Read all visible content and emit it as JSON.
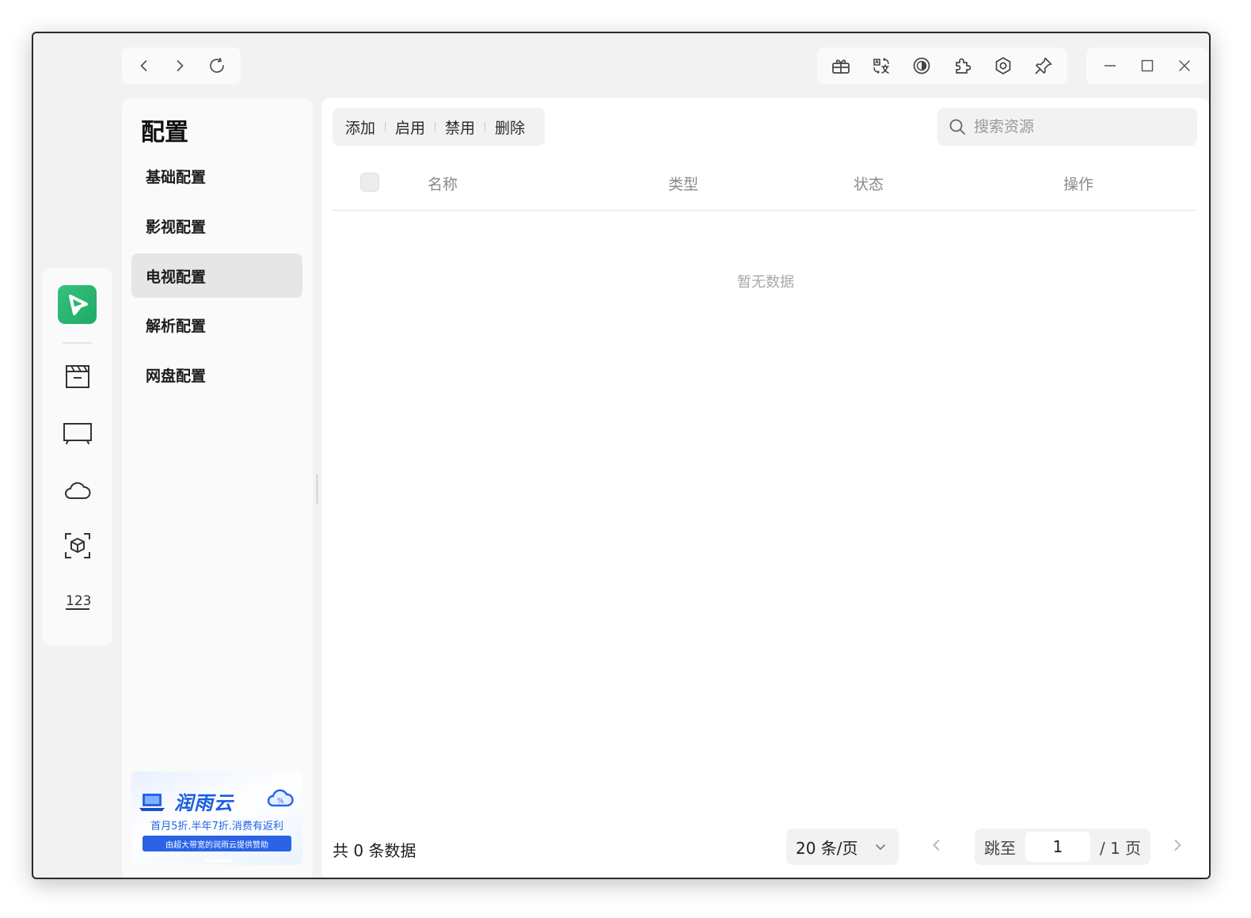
{
  "colors": {
    "accent": "#1fa968",
    "window_bg": "#f2f2f2",
    "panel_bg": "#fafafa",
    "active_item": "#e6e6e6",
    "ad_blue": "#2a63e6"
  },
  "titlebar": {
    "nav_icons": [
      "back-icon",
      "forward-icon",
      "refresh-icon"
    ],
    "tool_icons": [
      "gift-icon",
      "translate-icon",
      "theme-icon",
      "plugin-icon",
      "settings-icon",
      "pin-icon"
    ],
    "window_icons": [
      "minimize-icon",
      "maximize-icon",
      "close-icon"
    ]
  },
  "rail": {
    "logo_icon": "play-logo-icon",
    "icons": [
      "film-icon",
      "tv-icon",
      "cloud-icon",
      "cube-scan-icon",
      "numbers-icon"
    ]
  },
  "sidebar": {
    "title": "配置",
    "items": [
      {
        "label": "基础配置",
        "active": false
      },
      {
        "label": "影视配置",
        "active": false
      },
      {
        "label": "电视配置",
        "active": true
      },
      {
        "label": "解析配置",
        "active": false
      },
      {
        "label": "网盘配置",
        "active": false
      }
    ],
    "ad": {
      "brand": "润雨云",
      "line": "首月5折.半年7折.消费有返利",
      "sponsor": "由超大带宽的润雨云提供赞助"
    }
  },
  "toolbar": {
    "buttons": [
      "添加",
      "启用",
      "禁用",
      "删除"
    ]
  },
  "search": {
    "placeholder": "搜索资源",
    "value": ""
  },
  "table": {
    "columns": [
      "名称",
      "类型",
      "状态",
      "操作"
    ],
    "rows": [],
    "empty_text": "暂无数据"
  },
  "pagination": {
    "total_text": "共 0 条数据",
    "page_size": "20 条/页",
    "jump_label": "跳至",
    "current_page": "1",
    "total_pages": "/ 1 页"
  }
}
